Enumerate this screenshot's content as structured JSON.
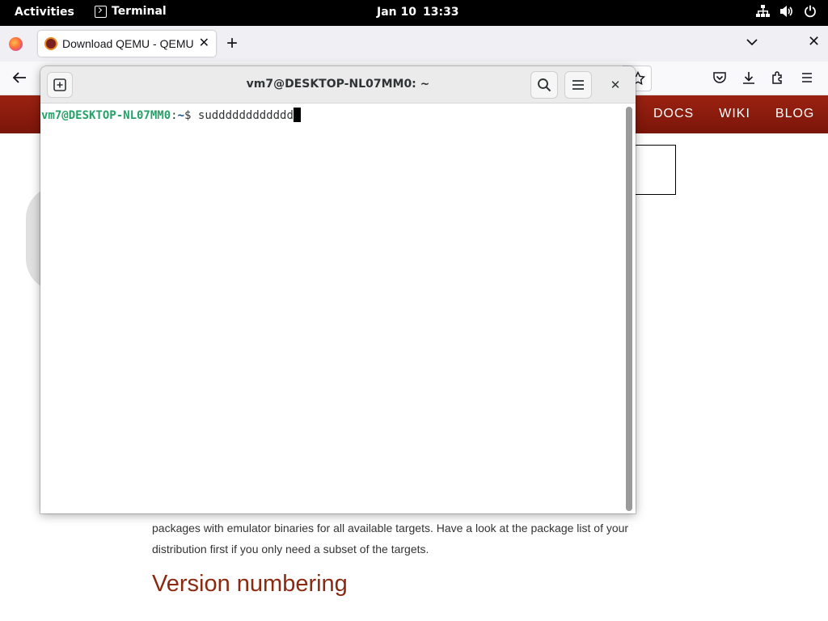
{
  "topbar": {
    "activities": "Activities",
    "app_name": "Terminal",
    "date": "Jan 10",
    "time": "13:33",
    "status_icons": [
      "network-icon",
      "volume-icon",
      "power-icon"
    ]
  },
  "browser": {
    "tab": {
      "title": "Download QEMU - QEMU",
      "favicon": "qemu-favicon"
    },
    "page": {
      "nav_links": [
        "DOCS",
        "WIKI",
        "BLOG"
      ],
      "paragraph_line1": "packages with emulator binaries for all available targets. Have a look at the package list of your",
      "paragraph_line2": "distribution first if you only need a subset of the targets.",
      "heading": "Version numbering",
      "brand_color": "#8b1a0e"
    }
  },
  "terminal": {
    "title": "vm7@DESKTOP-NL07MM0: ~",
    "prompt_user": "vm7@DESKTOP-NL07MM0",
    "prompt_sep": ":",
    "prompt_path": "~",
    "prompt_symbol": "$ ",
    "command": "sudddddddddddd"
  }
}
